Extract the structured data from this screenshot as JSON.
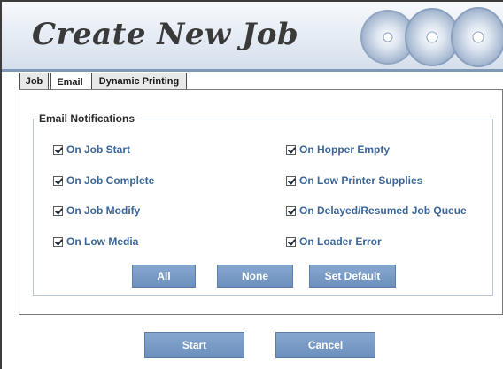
{
  "window": {
    "title": "Create New Job"
  },
  "tabs": [
    {
      "label": "Job",
      "active": false
    },
    {
      "label": "Email",
      "active": true
    },
    {
      "label": "Dynamic Printing",
      "active": false
    }
  ],
  "email_notifications": {
    "legend": "Email Notifications",
    "left_options": [
      {
        "label": "On Job Start",
        "checked": true
      },
      {
        "label": "On Job Complete",
        "checked": true
      },
      {
        "label": "On Job Modify",
        "checked": true
      },
      {
        "label": "On Low Media",
        "checked": true
      }
    ],
    "right_options": [
      {
        "label": "On Hopper Empty",
        "checked": true
      },
      {
        "label": "On Low Printer Supplies",
        "checked": true
      },
      {
        "label": "On Delayed/Resumed Job Queue",
        "checked": true
      },
      {
        "label": "On Loader Error",
        "checked": true
      }
    ],
    "buttons": {
      "all": "All",
      "none": "None",
      "set_default": "Set Default"
    }
  },
  "footer": {
    "start": "Start",
    "cancel": "Cancel"
  },
  "colors": {
    "accent": "#7294c2",
    "label": "#3b6596",
    "header_rule": "#7f97b8"
  },
  "icons": {
    "header_art": "disc-stack-icon",
    "checkbox": "checkmark-icon"
  }
}
